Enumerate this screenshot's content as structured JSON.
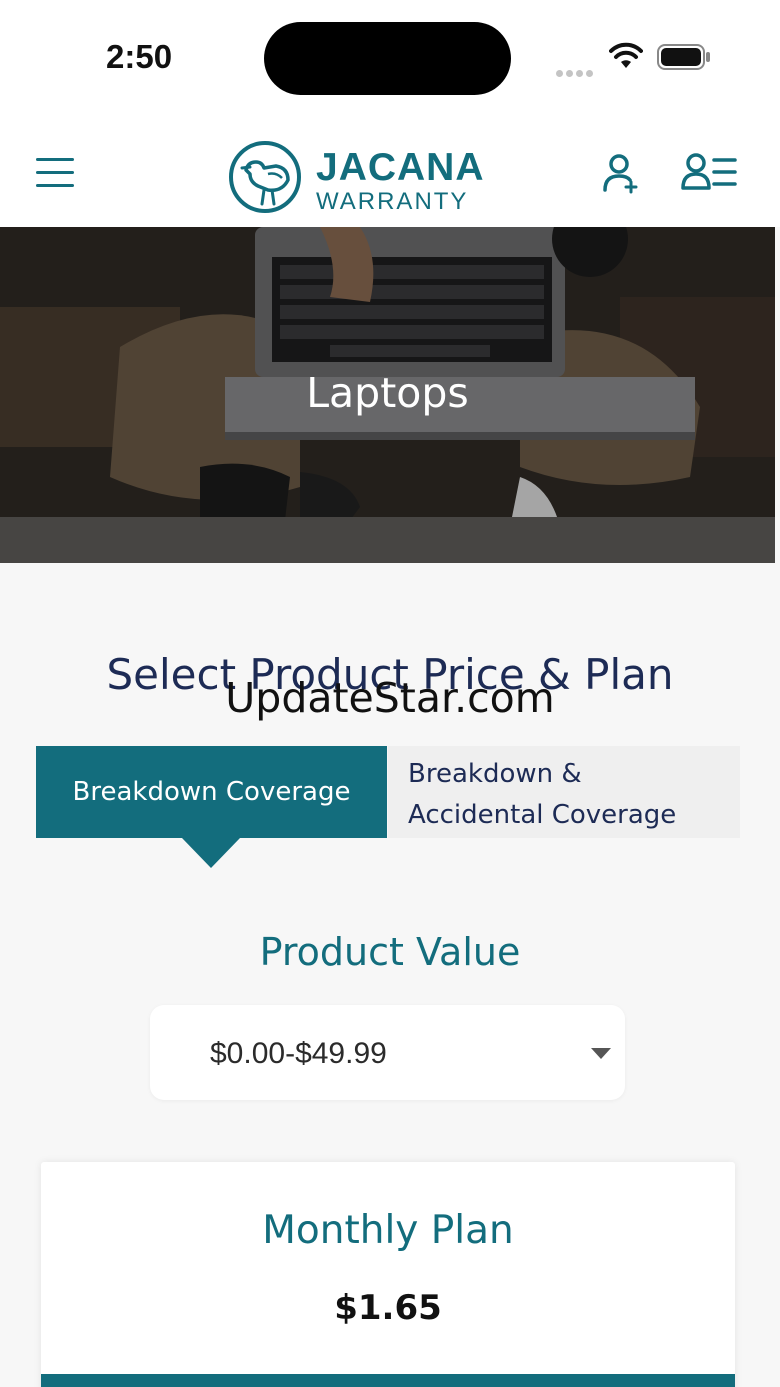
{
  "status_bar": {
    "time": "2:50"
  },
  "header": {
    "brand_name": "JACANA",
    "brand_sub": "WARRANTY",
    "icons": [
      "menu-icon",
      "add-user-icon",
      "account-list-icon"
    ]
  },
  "hero": {
    "title": "Laptops"
  },
  "section": {
    "title": "Select Product Price & Plan",
    "watermark": "UpdateStar.com"
  },
  "tabs": [
    {
      "label": "Breakdown Coverage",
      "active": true
    },
    {
      "label_line1": "Breakdown &",
      "label_line2": "Accidental Coverage",
      "active": false
    }
  ],
  "product_value": {
    "title": "Product Value",
    "selected": "$0.00-$49.99"
  },
  "plan": {
    "title": "Monthly Plan",
    "price": "$1.65"
  },
  "colors": {
    "brand": "#136d7d",
    "heading": "#1d2b55",
    "background": "#f7f7f7"
  }
}
